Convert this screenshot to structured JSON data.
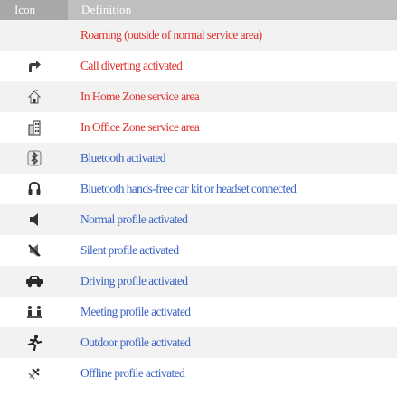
{
  "header": {
    "icon_col": "Icon",
    "definition_col": "Definition"
  },
  "colors": {
    "header_bg": "#bfbfbf",
    "header_icon_bg": "#a8a8a8",
    "row_alt_bg": "#f2f2f2",
    "red_text": "#e0302c",
    "blue_text": "#3a63c4"
  },
  "rows": [
    {
      "icon": "none",
      "text": "Roaming (outside of normal service area)",
      "color": "red"
    },
    {
      "icon": "call-divert-icon",
      "text": "Call diverting activated",
      "color": "red"
    },
    {
      "icon": "home-zone-icon",
      "text": "In Home Zone service area",
      "color": "red"
    },
    {
      "icon": "office-zone-icon",
      "text": "In Office Zone service area",
      "color": "red"
    },
    {
      "icon": "bluetooth-icon",
      "text": "Bluetooth activated",
      "color": "blue"
    },
    {
      "icon": "headset-icon",
      "text": "Bluetooth hands-free car kit or headset connected",
      "color": "blue"
    },
    {
      "icon": "speaker-icon",
      "text": "Normal profile activated",
      "color": "blue"
    },
    {
      "icon": "silent-speaker-icon",
      "text": "Silent profile activated",
      "color": "blue"
    },
    {
      "icon": "car-icon",
      "text": "Driving profile activated",
      "color": "blue"
    },
    {
      "icon": "meeting-icon",
      "text": "Meeting profile activated",
      "color": "blue"
    },
    {
      "icon": "running-man-icon",
      "text": "Outdoor profile activated",
      "color": "blue"
    },
    {
      "icon": "offline-icon",
      "text": "Offline profile activated",
      "color": "blue"
    }
  ]
}
